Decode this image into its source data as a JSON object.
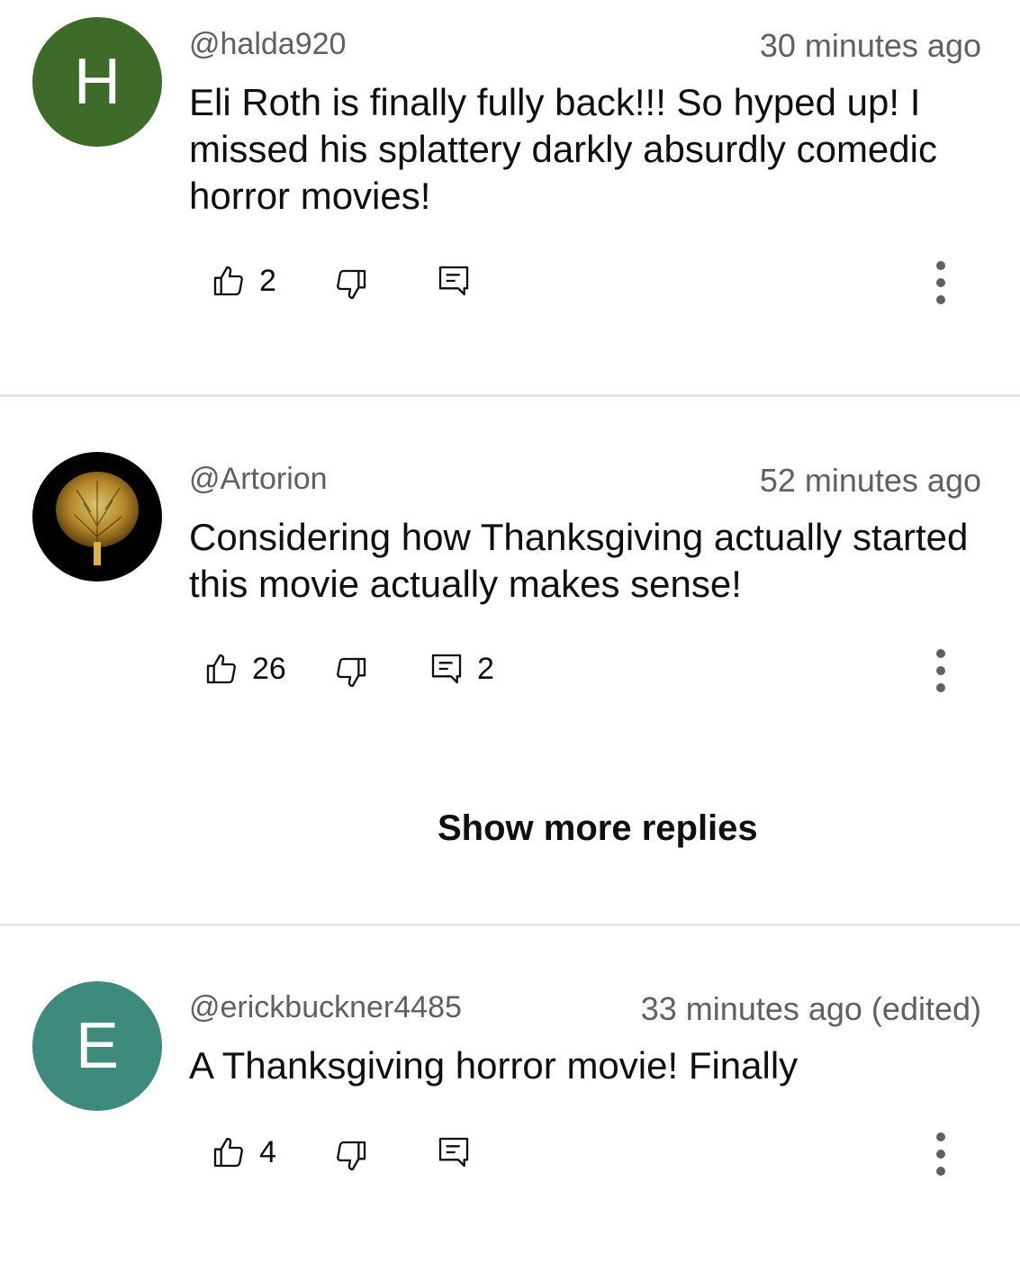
{
  "comments": [
    {
      "avatar_letter": "H",
      "avatar_color": "#3e6b2a",
      "handle": "@halda920",
      "time": "30 minutes ago",
      "text": "Eli Roth is finally fully back!!! So hyped up! I missed his splattery darkly absurdly comedic horror movies!",
      "likes": "2",
      "replies": ""
    },
    {
      "avatar_icon": "golden-tree-icon",
      "avatar_color": "#000000",
      "handle": "@Artorion",
      "time": "52 minutes ago",
      "text": "Considering how Thanksgiving actually started this movie actually makes sense!",
      "likes": "26",
      "replies": "2"
    },
    {
      "avatar_letter": "E",
      "avatar_color": "#3e8a7c",
      "handle": "@erickbuckner4485",
      "time": "33 minutes ago (edited)",
      "text": "A Thanksgiving horror movie! Finally",
      "likes": "4",
      "replies": ""
    }
  ],
  "show_more_replies": "Show more replies",
  "icons": {
    "like": "thumbs-up-icon",
    "dislike": "thumbs-down-icon",
    "reply": "reply-icon",
    "more": "more-vertical-icon"
  }
}
